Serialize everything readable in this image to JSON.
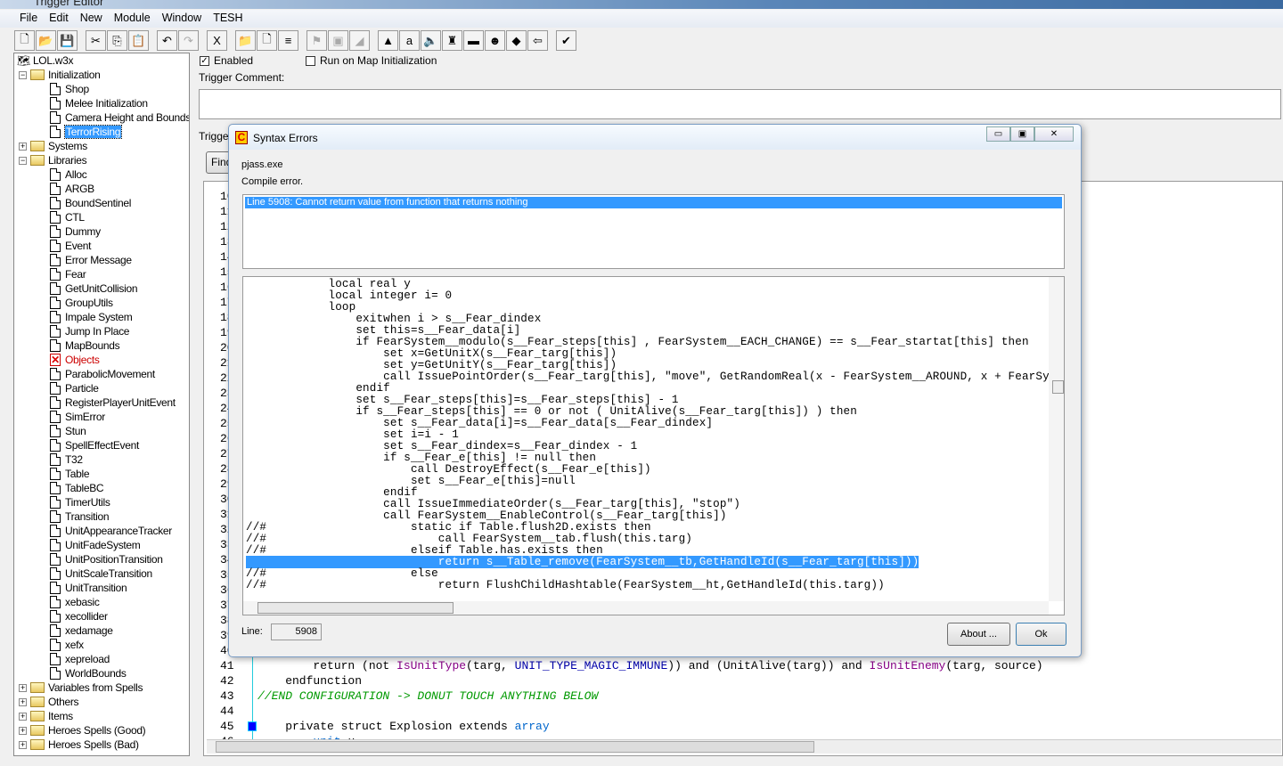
{
  "window": {
    "title": "Trigger Editor"
  },
  "menu": [
    "File",
    "Edit",
    "New",
    "Module",
    "Window",
    "TESH"
  ],
  "toolbar": [
    {
      "icon": "new-icon",
      "g": "🗋"
    },
    {
      "icon": "open-icon",
      "g": "📂"
    },
    {
      "icon": "save-icon",
      "g": "💾"
    },
    {
      "sep": true
    },
    {
      "icon": "cut-icon",
      "g": "✂"
    },
    {
      "icon": "copy-icon",
      "g": "⎘"
    },
    {
      "icon": "paste-icon",
      "g": "📋"
    },
    {
      "sep": true
    },
    {
      "icon": "undo-icon",
      "g": "↶"
    },
    {
      "icon": "redo-icon",
      "g": "↷",
      "dis": true
    },
    {
      "sep": true
    },
    {
      "icon": "close-x-icon",
      "g": "X"
    },
    {
      "sep": true
    },
    {
      "icon": "new-category-icon",
      "g": "📁"
    },
    {
      "icon": "new-trigger-icon",
      "g": "🗋"
    },
    {
      "icon": "new-comment-icon",
      "g": "≡"
    },
    {
      "sep": true
    },
    {
      "icon": "new-event-icon",
      "g": "⚑",
      "dis": true
    },
    {
      "icon": "new-condition-icon",
      "g": "▣",
      "dis": true
    },
    {
      "icon": "new-action-icon",
      "g": "◢",
      "dis": true
    },
    {
      "sep": true
    },
    {
      "icon": "terrain-editor-icon",
      "g": "▲"
    },
    {
      "icon": "trigger-editor-icon",
      "g": "a"
    },
    {
      "icon": "sound-editor-icon",
      "g": "🔈"
    },
    {
      "icon": "object-editor-icon",
      "g": "♜"
    },
    {
      "icon": "campaign-editor-icon",
      "g": "▬"
    },
    {
      "icon": "ai-editor-icon",
      "g": "☻"
    },
    {
      "icon": "object-manager-icon",
      "g": "◆"
    },
    {
      "icon": "import-manager-icon",
      "g": "⇦"
    },
    {
      "sep": true
    },
    {
      "icon": "test-map-icon",
      "g": "✔"
    }
  ],
  "tree": {
    "root": "LOL.w3x",
    "items": [
      {
        "l": "Initialization",
        "t": "folder",
        "d": 1,
        "open": true
      },
      {
        "l": "Shop",
        "t": "trigger",
        "d": 2
      },
      {
        "l": "Melee Initialization",
        "t": "trigger",
        "d": 2
      },
      {
        "l": "Camera Height and Bounds",
        "t": "trigger",
        "d": 2
      },
      {
        "l": "TerrorRising",
        "t": "trigger",
        "d": 2,
        "selected": true
      },
      {
        "l": "Systems",
        "t": "folder",
        "d": 1
      },
      {
        "l": "Libraries",
        "t": "folder",
        "d": 1,
        "open": true
      },
      {
        "l": "Alloc",
        "t": "trigger",
        "d": 2
      },
      {
        "l": "ARGB",
        "t": "trigger",
        "d": 2
      },
      {
        "l": "BoundSentinel",
        "t": "trigger",
        "d": 2
      },
      {
        "l": "CTL",
        "t": "trigger",
        "d": 2
      },
      {
        "l": "Dummy",
        "t": "trigger",
        "d": 2
      },
      {
        "l": "Event",
        "t": "trigger",
        "d": 2
      },
      {
        "l": "Error Message",
        "t": "trigger",
        "d": 2
      },
      {
        "l": "Fear",
        "t": "trigger",
        "d": 2
      },
      {
        "l": "GetUnitCollision",
        "t": "trigger",
        "d": 2
      },
      {
        "l": "GroupUtils",
        "t": "trigger",
        "d": 2
      },
      {
        "l": "Impale System",
        "t": "trigger",
        "d": 2
      },
      {
        "l": "Jump In Place",
        "t": "trigger",
        "d": 2
      },
      {
        "l": "MapBounds",
        "t": "trigger",
        "d": 2
      },
      {
        "l": "Objects",
        "t": "disabled",
        "d": 2
      },
      {
        "l": "ParabolicMovement",
        "t": "trigger",
        "d": 2
      },
      {
        "l": "Particle",
        "t": "trigger",
        "d": 2
      },
      {
        "l": "RegisterPlayerUnitEvent",
        "t": "trigger",
        "d": 2
      },
      {
        "l": "SimError",
        "t": "trigger",
        "d": 2
      },
      {
        "l": "Stun",
        "t": "trigger",
        "d": 2
      },
      {
        "l": "SpellEffectEvent",
        "t": "trigger",
        "d": 2
      },
      {
        "l": "T32",
        "t": "trigger",
        "d": 2
      },
      {
        "l": "Table",
        "t": "trigger",
        "d": 2
      },
      {
        "l": "TableBC",
        "t": "trigger",
        "d": 2
      },
      {
        "l": "TimerUtils",
        "t": "trigger",
        "d": 2
      },
      {
        "l": "Transition",
        "t": "trigger",
        "d": 2
      },
      {
        "l": "UnitAppearanceTracker",
        "t": "trigger",
        "d": 2
      },
      {
        "l": "UnitFadeSystem",
        "t": "trigger",
        "d": 2
      },
      {
        "l": "UnitPositionTransition",
        "t": "trigger",
        "d": 2
      },
      {
        "l": "UnitScaleTransition",
        "t": "trigger",
        "d": 2
      },
      {
        "l": "UnitTransition",
        "t": "trigger",
        "d": 2
      },
      {
        "l": "xebasic",
        "t": "trigger",
        "d": 2
      },
      {
        "l": "xecollider",
        "t": "trigger",
        "d": 2
      },
      {
        "l": "xedamage",
        "t": "trigger",
        "d": 2
      },
      {
        "l": "xefx",
        "t": "trigger",
        "d": 2
      },
      {
        "l": "xepreload",
        "t": "trigger",
        "d": 2
      },
      {
        "l": "WorldBounds",
        "t": "trigger",
        "d": 2
      },
      {
        "l": "Variables from Spells",
        "t": "folder",
        "d": 1
      },
      {
        "l": "Others",
        "t": "folder",
        "d": 1
      },
      {
        "l": "Items",
        "t": "folder",
        "d": 1
      },
      {
        "l": "Heroes Spells (Good)",
        "t": "folder",
        "d": 1
      },
      {
        "l": "Heroes Spells (Bad)",
        "t": "folder",
        "d": 1
      }
    ]
  },
  "trigger": {
    "enabled_label": "Enabled",
    "enabled": true,
    "run_on_init_label": "Run on Map Initialization",
    "run_on_init": false,
    "comment_label": "Trigger Comment:",
    "comment_value": "",
    "text_label": "Trigger",
    "find_label": "Find"
  },
  "editor": {
    "first_line": 10,
    "lines": [
      {
        "n": 41,
        "html": "        return (not <span style='color:#808'>IsUnitType</span>(targ, <span style='color:#00a'>UNIT_TYPE_MAGIC_IMMUNE</span>)) and (UnitAlive(targ)) and <span style='color:#808'>IsUnitEnemy</span>(targ, source)"
      },
      {
        "n": 42,
        "html": "    endfunction"
      },
      {
        "n": 43,
        "html": "<span style='color:#090;font-style:italic'>//END CONFIGURATION -> DONUT TOUCH ANYTHING BELOW</span>"
      },
      {
        "n": 44,
        "html": ""
      },
      {
        "n": 45,
        "html": "    private struct Explosion extends <span style='color:#06c'>array</span>"
      },
      {
        "n": 46,
        "html": "        <span style='color:#06c'>unit</span> u"
      }
    ]
  },
  "dialog": {
    "title": "Syntax Errors",
    "tool": "pjass.exe",
    "status": "Compile error.",
    "errors": [
      "Line 5908:  Cannot return value from function that returns nothing"
    ],
    "code": [
      "            local real y",
      "            local integer i= 0",
      "            loop",
      "                exitwhen i > s__Fear_dindex",
      "                set this=s__Fear_data[i]",
      "                if FearSystem__modulo(s__Fear_steps[this] , FearSystem__EACH_CHANGE) == s__Fear_startat[this] then",
      "                    set x=GetUnitX(s__Fear_targ[this])",
      "                    set y=GetUnitY(s__Fear_targ[this])",
      "                    call IssuePointOrder(s__Fear_targ[this], \"move\", GetRandomReal(x - FearSystem__AROUND, x + FearSystem__AROUND), GetRandomReal(y - FearSystem__AROUND, y + FearSystem__AROUND))",
      "                endif",
      "                set s__Fear_steps[this]=s__Fear_steps[this] - 1",
      "                if s__Fear_steps[this] == 0 or not ( UnitAlive(s__Fear_targ[this]) ) then",
      "                    set s__Fear_data[i]=s__Fear_data[s__Fear_dindex]",
      "                    set i=i - 1",
      "                    set s__Fear_dindex=s__Fear_dindex - 1",
      "                    if s__Fear_e[this] != null then",
      "                        call DestroyEffect(s__Fear_e[this])",
      "                        set s__Fear_e[this]=null",
      "                    endif",
      "                    call IssueImmediateOrder(s__Fear_targ[this], \"stop\")",
      "                    call FearSystem__EnableControl(s__Fear_targ[this])",
      "//#                     static if Table.flush2D.exists then",
      "//#                         call FearSystem__tab.flush(this.targ)",
      "//#                     elseif Table.has.exists then",
      "                            return s__Table_remove(FearSystem__tb,GetHandleId(s__Fear_targ[this]))",
      "//#                     else",
      "//#                         return FlushChildHashtable(FearSystem__ht,GetHandleId(this.targ))"
    ],
    "highlighted_index": 24,
    "line_label": "Line:",
    "line_value": "5908",
    "about_label": "About ...",
    "ok_label": "Ok"
  }
}
